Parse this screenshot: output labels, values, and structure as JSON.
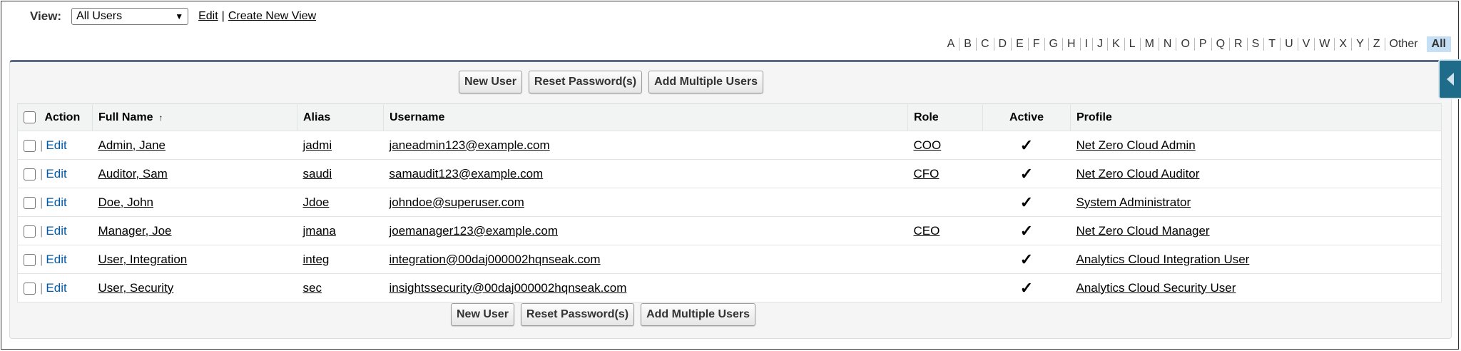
{
  "view": {
    "label": "View:",
    "selected": "All Users",
    "edit_link": "Edit",
    "separator": "|",
    "create_link": "Create New View"
  },
  "alphabet": [
    "A",
    "B",
    "C",
    "D",
    "E",
    "F",
    "G",
    "H",
    "I",
    "J",
    "K",
    "L",
    "M",
    "N",
    "O",
    "P",
    "Q",
    "R",
    "S",
    "T",
    "U",
    "V",
    "W",
    "X",
    "Y",
    "Z",
    "Other"
  ],
  "alphabet_all": "All",
  "buttons": {
    "new_user": "New User",
    "reset_password": "Reset Password(s)",
    "add_multiple": "Add Multiple Users"
  },
  "table": {
    "headers": {
      "action": "Action",
      "full_name": "Full Name",
      "sort_indicator": "↑",
      "alias": "Alias",
      "username": "Username",
      "role": "Role",
      "active": "Active",
      "profile": "Profile"
    },
    "edit_label": "Edit",
    "pipe": "|",
    "check_mark": "✓",
    "rows": [
      {
        "full_name": "Admin, Jane",
        "alias": "jadmi",
        "username": "janeadmin123@example.com",
        "role": "COO",
        "active": true,
        "profile": "Net Zero Cloud Admin"
      },
      {
        "full_name": "Auditor, Sam",
        "alias": "saudi",
        "username": "samaudit123@example.com",
        "role": "CFO",
        "active": true,
        "profile": "Net Zero Cloud Auditor"
      },
      {
        "full_name": "Doe, John",
        "alias": "Jdoe",
        "username": "johndoe@superuser.com",
        "role": "",
        "active": true,
        "profile": "System Administrator"
      },
      {
        "full_name": "Manager, Joe",
        "alias": "jmana",
        "username": "joemanager123@example.com",
        "role": "CEO",
        "active": true,
        "profile": "Net Zero Cloud Manager"
      },
      {
        "full_name": "User, Integration",
        "alias": "integ",
        "username": "integration@00daj000002hqnseak.com",
        "role": "",
        "active": true,
        "profile": "Analytics Cloud Integration User"
      },
      {
        "full_name": "User, Security",
        "alias": "sec",
        "username": "insightssecurity@00daj000002hqnseak.com",
        "role": "",
        "active": true,
        "profile": "Analytics Cloud Security User"
      }
    ]
  },
  "colors": {
    "panel_border": "#5a6b84",
    "edit_link": "#015ba7",
    "sidetab": "#1e6b8a",
    "alpha_selected": "#c5e0f5"
  }
}
